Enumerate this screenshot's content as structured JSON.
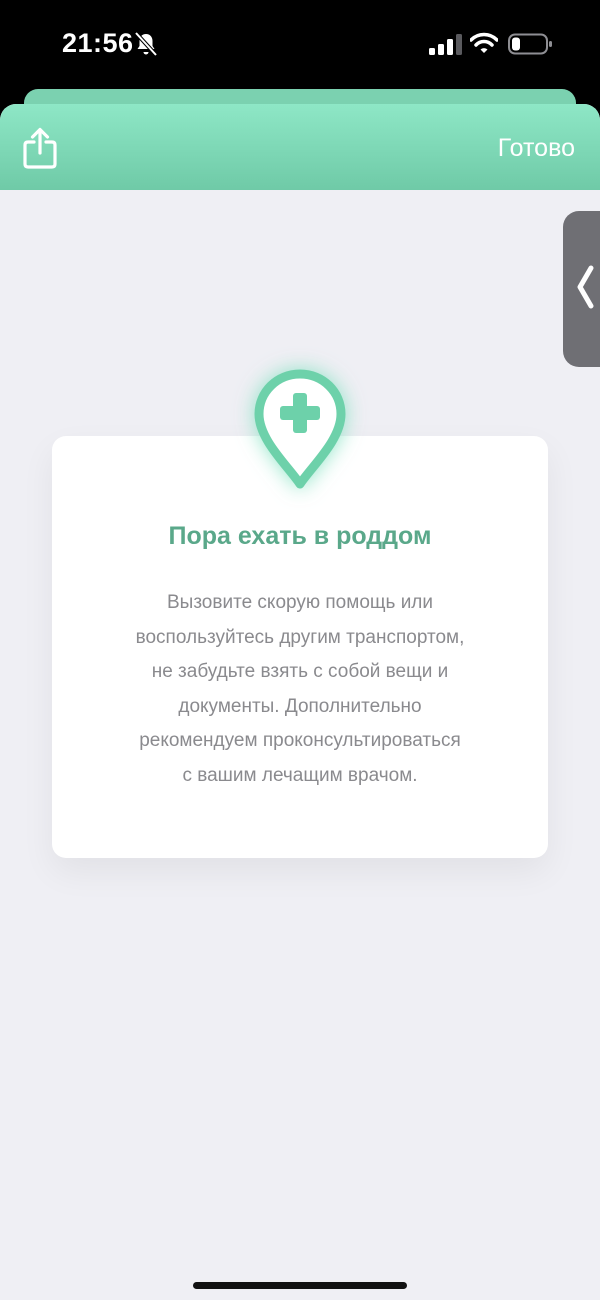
{
  "status_bar": {
    "time": "21:56",
    "icons": [
      "bell-slash-icon",
      "signal-icon",
      "wifi-icon",
      "battery-icon"
    ]
  },
  "header": {
    "share_icon": "share-icon",
    "done_label": "Готово"
  },
  "side_handle": {
    "icon": "chevron-left-icon"
  },
  "card": {
    "icon": "map-pin-plus-icon",
    "title": "Пора ехать в роддом",
    "lines": [
      "Вызовите скорую помощь или",
      "воспользуйтесь другим транспортом,",
      "не забудьте взять с собой вещи и",
      "документы. Дополнительно",
      "рекомендуем проконсультироваться",
      "с вашим лечащим врачом."
    ]
  },
  "colors": {
    "header_start": "#8ee7c6",
    "header_end": "#6fcaa7",
    "accent": "#5aa88a",
    "pin": "#6dd1aa",
    "background": "#efeff4"
  }
}
